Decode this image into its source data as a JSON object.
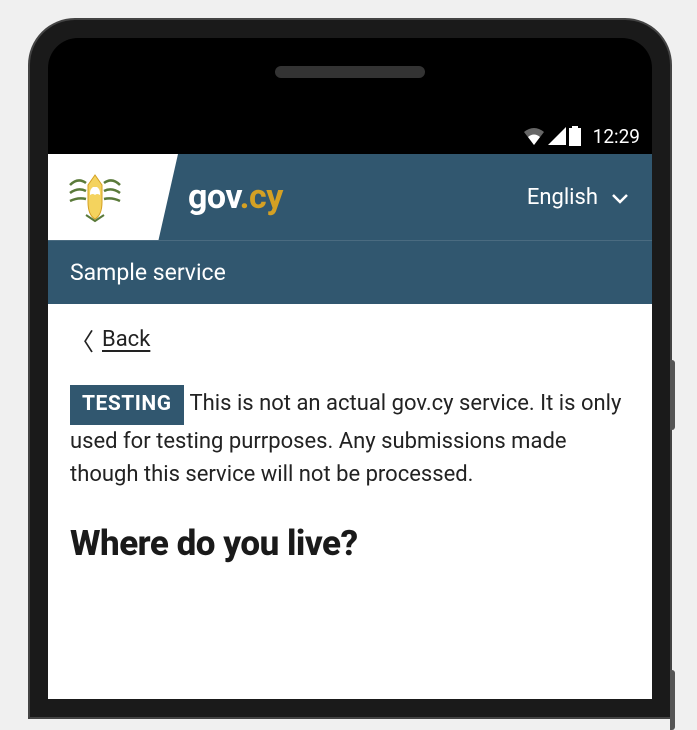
{
  "status": {
    "time": "12:29"
  },
  "header": {
    "brand_gov": "gov",
    "brand_dot": ".",
    "brand_cy": "cy",
    "language": "English",
    "service_name": "Sample service"
  },
  "nav": {
    "back_label": "Back"
  },
  "notice": {
    "badge": "TESTING",
    "text": "This is not an actual gov.cy service. It is only used for testing purrposes. Any submissions made though this service will not be processed."
  },
  "page": {
    "heading": "Where do you live?"
  }
}
